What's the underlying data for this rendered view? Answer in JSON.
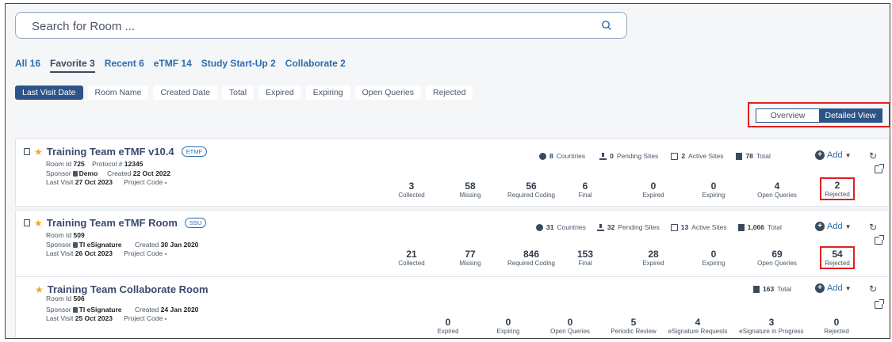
{
  "search": {
    "placeholder": "Search for Room ...",
    "icon": "search-icon"
  },
  "tabs": [
    {
      "label": "All 16"
    },
    {
      "label": "Favorite 3",
      "active": true
    },
    {
      "label": "Recent 6"
    },
    {
      "label": "eTMF 14"
    },
    {
      "label": "Study Start-Up 2"
    },
    {
      "label": "Collaborate 2"
    }
  ],
  "sort_options": [
    {
      "label": "Last Visit Date",
      "active": true
    },
    {
      "label": "Room Name"
    },
    {
      "label": "Created Date"
    },
    {
      "label": "Total"
    },
    {
      "label": "Expired"
    },
    {
      "label": "Expiring"
    },
    {
      "label": "Open Queries"
    },
    {
      "label": "Rejected"
    }
  ],
  "view_toggle": {
    "overview": "Overview",
    "detailed": "Detailed View",
    "selected": "Detailed View"
  },
  "actions": {
    "add": "Add"
  },
  "rooms": [
    {
      "title": "Training Team eTMF v10.4",
      "badge": "ETMF",
      "room_id_label": "Room Id",
      "room_id": "725",
      "protocol_label": "Protocol #",
      "protocol": "12345",
      "sponsor_label": "Sponsor",
      "sponsor": "Demo",
      "created_label": "Created",
      "created": "22 Oct 2022",
      "last_visit_label": "Last Visit",
      "last_visit": "27 Oct 2023",
      "project_code_label": "Project Code",
      "project_code": "-",
      "countries": "8",
      "countries_label": "Countries",
      "pending_sites": "0",
      "pending_sites_label": "Pending Sites",
      "active_sites": "2",
      "active_sites_label": "Active Sites",
      "total": "78",
      "total_label": "Total",
      "stats": [
        {
          "value": "3",
          "label": "Collected"
        },
        {
          "value": "58",
          "label": "Missing"
        },
        {
          "value": "56",
          "label": "Required Coding"
        },
        {
          "value": "6",
          "label": "Final"
        },
        {
          "value": "0",
          "label": "Expired"
        },
        {
          "value": "0",
          "label": "Expiring"
        },
        {
          "value": "4",
          "label": "Open Queries"
        },
        {
          "value": "2",
          "label": "Rejected"
        }
      ]
    },
    {
      "title": "Training Team eTMF Room",
      "badge": "SSU",
      "room_id_label": "Room Id",
      "room_id": "509",
      "sponsor_label": "Sponsor",
      "sponsor": "TI eSignature",
      "created_label": "Created",
      "created": "30 Jan 2020",
      "last_visit_label": "Last Visit",
      "last_visit": "26 Oct 2023",
      "project_code_label": "Project Code",
      "project_code": "-",
      "countries": "31",
      "countries_label": "Countries",
      "pending_sites": "32",
      "pending_sites_label": "Pending Sites",
      "active_sites": "13",
      "active_sites_label": "Active Sites",
      "total": "1,066",
      "total_label": "Total",
      "stats": [
        {
          "value": "21",
          "label": "Collected"
        },
        {
          "value": "77",
          "label": "Missing"
        },
        {
          "value": "846",
          "label": "Required Coding"
        },
        {
          "value": "153",
          "label": "Final"
        },
        {
          "value": "28",
          "label": "Expired"
        },
        {
          "value": "0",
          "label": "Expiring"
        },
        {
          "value": "69",
          "label": "Open Queries"
        },
        {
          "value": "54",
          "label": "Rejected"
        }
      ]
    },
    {
      "title": "Training Team Collaborate Room",
      "room_id_label": "Room Id",
      "room_id": "506",
      "sponsor_label": "Sponsor",
      "sponsor": "TI eSignature",
      "created_label": "Created",
      "created": "24 Jan 2020",
      "last_visit_label": "Last Visit",
      "last_visit": "25 Oct 2023",
      "project_code_label": "Project Code",
      "project_code": "-",
      "total": "163",
      "total_label": "Total",
      "stats": [
        {
          "value": "0",
          "label": "Expired"
        },
        {
          "value": "0",
          "label": "Expiring"
        },
        {
          "value": "0",
          "label": "Open Queries"
        },
        {
          "value": "5",
          "label": "Periodic Review"
        },
        {
          "value": "4",
          "label": "eSignature Requests"
        },
        {
          "value": "3",
          "label": "eSignature in Progress"
        },
        {
          "value": "0",
          "label": "Rejected"
        }
      ]
    }
  ],
  "colors": {
    "accent": "#2d5486",
    "link": "#2b6cb0",
    "star": "#f5a623",
    "highlight": "#e02020"
  }
}
